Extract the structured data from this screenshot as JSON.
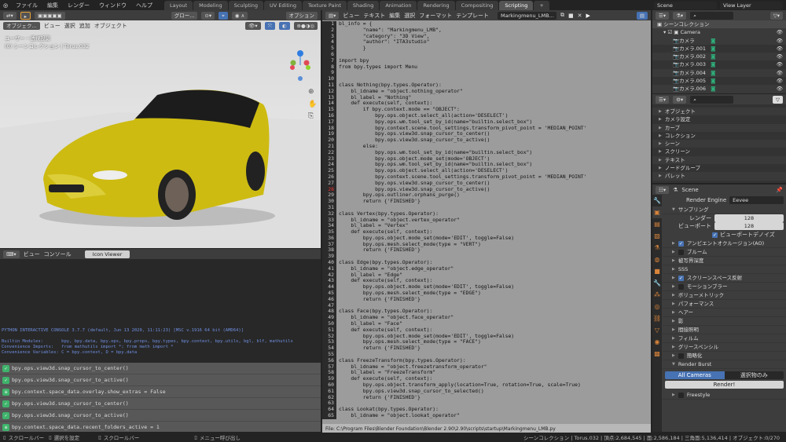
{
  "topbar": {
    "menus": [
      "ファイル",
      "編集",
      "レンダー",
      "ウィンドウ",
      "ヘルプ"
    ],
    "tabs": [
      "Layout",
      "Modeling",
      "Sculpting",
      "UV Editing",
      "Texture Paint",
      "Shading",
      "Animation",
      "Rendering",
      "Compositing",
      "Scripting"
    ],
    "active_tab": "Scripting",
    "scene": "Scene",
    "view_layer": "View Layer"
  },
  "viewport": {
    "transform": "グロー...",
    "options": "オプション",
    "mode": "オブジェク...",
    "menus": [
      "ビュー",
      "選択",
      "追加",
      "オブジェクト"
    ],
    "overlay_line1": "ユーザー・透視投影",
    "overlay_line2": "(0) シーンコレクション | Torus.032"
  },
  "console": {
    "menus": [
      "ビュー",
      "コンソール"
    ],
    "tab": "Icon Viewer",
    "lines": [
      "PYTHON INTERACTIVE CONSOLE 3.7.7 (default, Jun 13 2020, 11:11:23) [MSC v.1916 64 bit (AMD64)]",
      "",
      "Builtin Modules:       bpy, bpy.data, bpy.ops, bpy.props, bpy.types, bpy.context, bpy.utils, bgl, blf, mathutils",
      "Convenience Imports:   from mathutils import *; from math import *",
      "Convenience Variables: C = bpy.context, D = bpy.data"
    ],
    "prompt": ">>> "
  },
  "info_log": [
    {
      "icon": "check",
      "text": "bpy.ops.view3d.snap_cursor_to_center()"
    },
    {
      "icon": "check",
      "text": "bpy.ops.view3d.snap_cursor_to_active()"
    },
    {
      "icon": "property",
      "text": "bpy.context.space_data.overlay.show_extras = False"
    },
    {
      "icon": "check",
      "text": "bpy.ops.view3d.snap_cursor_to_center()"
    },
    {
      "icon": "check",
      "text": "bpy.ops.view3d.snap_cursor_to_active()"
    },
    {
      "icon": "property",
      "text": "bpy.context.space_data.recent_folders_active = 1"
    }
  ],
  "editor": {
    "menus": [
      "ビュー",
      "テキスト",
      "編集",
      "選択",
      "フォーマット",
      "テンプレート"
    ],
    "filename": "Markingmenu_LMB...",
    "footer": "File: C:\\Program Files\\Blender Foundation\\Blender 2.90\\2.90\\scripts\\startup\\Markingmenu_LMB.py"
  },
  "code": {
    "lines": [
      "bl_info = {",
      "        \"name\": \"Markingmenu_LMB\",",
      "        \"category\": \"3D View\",",
      "        \"author\": \"ITA3studio\"",
      "        }",
      "",
      "import bpy",
      "from bpy.types import Menu",
      "",
      "",
      "class Nothing(bpy.types.Operator):",
      "    bl_idname = \"object.nothing_operator\"",
      "    bl_label = \"Nothing\"",
      "    def execute(self, context):",
      "        if bpy.context.mode == \"OBJECT\":",
      "            bpy.ops.object.select_all(action='DESELECT')",
      "            bpy.ops.wm.tool_set_by_id(name=\"builtin.select_box\")",
      "            bpy.context.scene.tool_settings.transform_pivot_point = 'MEDIAN_POINT'",
      "            bpy.ops.view3d.snap_cursor_to_center()",
      "            bpy.ops.view3d.snap_cursor_to_active()",
      "        else:",
      "            bpy.ops.wm.tool_set_by_id(name=\"builtin.select_box\")",
      "            bpy.ops.object.mode_set(mode='OBJECT')",
      "            bpy.ops.wm.tool_set_by_id(name=\"builtin.select_box\")",
      "            bpy.ops.object.select_all(action='DESELECT')",
      "            bpy.context.scene.tool_settings.transform_pivot_point = 'MEDIAN_POINT'",
      "            bpy.ops.view3d.snap_cursor_to_center()",
      "            bpy.ops.view3d.snap_cursor_to_active()",
      "        bpy.ops.outliner.orphans_purge()",
      "        return {'FINISHED'}",
      "",
      "class Vertex(bpy.types.Operator):",
      "    bl_idname = \"object.vertex_operator\"",
      "    bl_label = \"Vertex\"",
      "    def execute(self, context):",
      "        bpy.ops.object.mode_set(mode='EDIT', toggle=False)",
      "        bpy.ops.mesh.select_mode(type = \"VERT\")",
      "        return {'FINISHED'}",
      "",
      "class Edge(bpy.types.Operator):",
      "    bl_idname = \"object.edge_operator\"",
      "    bl_label = \"Edge\"",
      "    def execute(self, context):",
      "        bpy.ops.object.mode_set(mode='EDIT', toggle=False)",
      "        bpy.ops.mesh.select_mode(type = \"EDGE\")",
      "        return {'FINISHED'}",
      "",
      "class Face(bpy.types.Operator):",
      "    bl_idname = \"object.face_operator\"",
      "    bl_label = \"Face\"",
      "    def execute(self, context):",
      "        bpy.ops.object.mode_set(mode='EDIT', toggle=False)",
      "        bpy.ops.mesh.select_mode(type = \"FACE\")",
      "        return {'FINISHED'}",
      "",
      "class FreezeTransform(bpy.types.Operator):",
      "    bl_idname = \"object.freezetransform_operator\"",
      "    bl_label = \"FreezeTransform\"",
      "    def execute(self, context):",
      "        bpy.ops.object.transform_apply(location=True, rotation=True, scale=True)",
      "        bpy.ops.view3d.snap_cursor_to_selected()",
      "        return {'FINISHED'}",
      "",
      "class Lookat(bpy.types.Operator):",
      "    bl_idname = \"object.lookat_operator\""
    ]
  },
  "outliner": {
    "root": "シーンコレクション",
    "collection": "Camera",
    "items": [
      "カメラ",
      "カメラ.001",
      "カメラ.002",
      "カメラ.003",
      "カメラ.004",
      "カメラ.005",
      "カメラ.006"
    ]
  },
  "blendfile": {
    "items": [
      "オブジェクト",
      "カメラ設定",
      "カーブ",
      "コレクション",
      "シーン",
      "スクリーン",
      "テキスト",
      "ノードグループ",
      "パレット"
    ]
  },
  "properties": {
    "scene": "Scene",
    "render_engine_label": "Render Engine",
    "render_engine": "Eevee",
    "sampling": "サンプリング",
    "render_label": "レンダー",
    "render_samples": "128",
    "viewport_label": "ビューポート",
    "viewport_samples": "128",
    "denoise": "ビューポートデノイズ",
    "panels": [
      {
        "label": "アンビエントオクルージョン(AO)",
        "check": "on"
      },
      {
        "label": "ブルーム",
        "check": "off"
      },
      {
        "label": "被写界深度",
        "check": ""
      },
      {
        "label": "SSS",
        "check": ""
      },
      {
        "label": "スクリーンスペース反射",
        "check": "on"
      },
      {
        "label": "モーションブラー",
        "check": "off"
      },
      {
        "label": "ボリューメトリック",
        "check": ""
      },
      {
        "label": "パフォーマンス",
        "check": ""
      },
      {
        "label": "ヘアー",
        "check": ""
      },
      {
        "label": "影",
        "check": ""
      },
      {
        "label": "間接照明",
        "check": ""
      },
      {
        "label": "フィルム",
        "check": ""
      },
      {
        "label": "グリースペンシル",
        "check": ""
      },
      {
        "label": "簡略化",
        "check": "off"
      }
    ],
    "render_burst": "Render Burst",
    "all_cameras": "All Cameras",
    "selected_only": "選択物のみ",
    "render_button": "Render!",
    "freestyle": "Freestyle"
  },
  "status": {
    "left": [
      "スクロールバー",
      "選択を設定",
      "スクロールバー",
      "メニュー呼び出し"
    ],
    "right": "シーンコレクション | Torus.032 | 頂点:2,684,545 | 面:2,586,184 | 三角面:5,136,414 | オブジェクト:0/270"
  },
  "colors": {
    "accent": "#4772b3",
    "car": "#d4c21a",
    "success": "#3fb36b"
  }
}
